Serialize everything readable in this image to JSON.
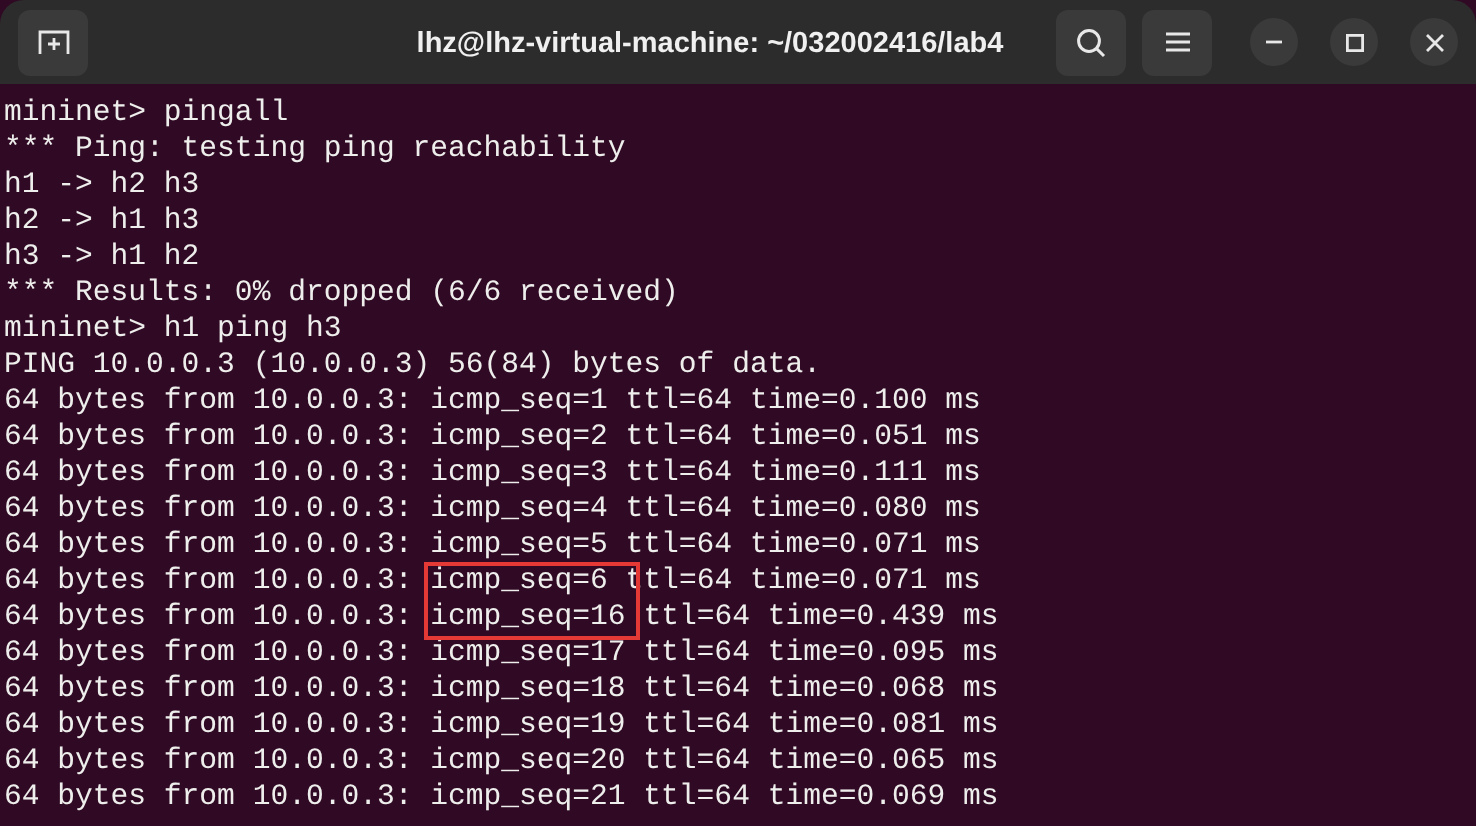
{
  "window": {
    "title": "lhz@lhz-virtual-machine: ~/032002416/lab4"
  },
  "terminal": {
    "lines": [
      {
        "segments": [
          {
            "text": "mininet> pingall",
            "boxed": false
          }
        ]
      },
      {
        "segments": [
          {
            "text": "*** Ping: testing ping reachability",
            "boxed": false
          }
        ]
      },
      {
        "segments": [
          {
            "text": "h1 -> h2 h3",
            "boxed": false
          }
        ]
      },
      {
        "segments": [
          {
            "text": "h2 -> h1 h3",
            "boxed": false
          }
        ]
      },
      {
        "segments": [
          {
            "text": "h3 -> h1 h2",
            "boxed": false
          }
        ]
      },
      {
        "segments": [
          {
            "text": "*** Results: 0% dropped (6/6 received)",
            "boxed": false
          }
        ]
      },
      {
        "segments": [
          {
            "text": "mininet> h1 ping h3",
            "boxed": false
          }
        ]
      },
      {
        "segments": [
          {
            "text": "PING 10.0.0.3 (10.0.0.3) 56(84) bytes of data.",
            "boxed": false
          }
        ]
      },
      {
        "segments": [
          {
            "text": "64 bytes from 10.0.0.3: icmp_seq=1 ttl=64 time=0.100 ms",
            "boxed": false
          }
        ]
      },
      {
        "segments": [
          {
            "text": "64 bytes from 10.0.0.3: icmp_seq=2 ttl=64 time=0.051 ms",
            "boxed": false
          }
        ]
      },
      {
        "segments": [
          {
            "text": "64 bytes from 10.0.0.3: icmp_seq=3 ttl=64 time=0.111 ms",
            "boxed": false
          }
        ]
      },
      {
        "segments": [
          {
            "text": "64 bytes from 10.0.0.3: icmp_seq=4 ttl=64 time=0.080 ms",
            "boxed": false
          }
        ]
      },
      {
        "segments": [
          {
            "text": "64 bytes from 10.0.0.3: icmp_seq=5 ttl=64 time=0.071 ms",
            "boxed": false
          }
        ]
      },
      {
        "segments": [
          {
            "text": "64 bytes from 10.0.0.3: ",
            "boxed": false
          },
          {
            "text": "icmp_seq=6",
            "boxed": true
          },
          {
            "text": " ttl=64 time=0.071 ms",
            "boxed": false
          }
        ]
      },
      {
        "segments": [
          {
            "text": "64 bytes from 10.0.0.3: ",
            "boxed": false
          },
          {
            "text": "icmp_seq=16",
            "boxed": true
          },
          {
            "text": " ttl=64 time=0.439 ms",
            "boxed": false
          }
        ]
      },
      {
        "segments": [
          {
            "text": "64 bytes from 10.0.0.3: icmp_seq=17 ttl=64 time=0.095 ms",
            "boxed": false
          }
        ]
      },
      {
        "segments": [
          {
            "text": "64 bytes from 10.0.0.3: icmp_seq=18 ttl=64 time=0.068 ms",
            "boxed": false
          }
        ]
      },
      {
        "segments": [
          {
            "text": "64 bytes from 10.0.0.3: icmp_seq=19 ttl=64 time=0.081 ms",
            "boxed": false
          }
        ]
      },
      {
        "segments": [
          {
            "text": "64 bytes from 10.0.0.3: icmp_seq=20 ttl=64 time=0.065 ms",
            "boxed": false
          }
        ]
      },
      {
        "segments": [
          {
            "text": "64 bytes from 10.0.0.3: icmp_seq=21 ttl=64 time=0.069 ms",
            "boxed": false
          }
        ]
      }
    ]
  }
}
